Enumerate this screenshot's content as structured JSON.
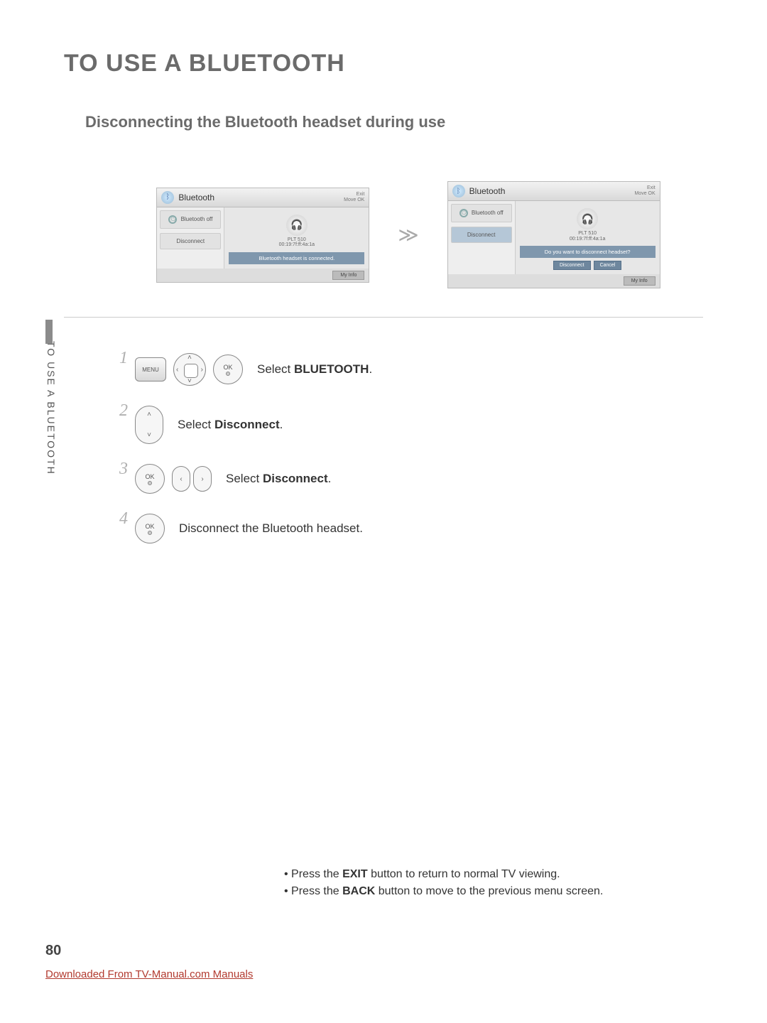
{
  "main_title": "TO USE A BLUETOOTH",
  "sub_title": "Disconnecting the Bluetooth headset during use",
  "sidetab": "TO USE A BLUETOOTH",
  "shot_common": {
    "title": "Bluetooth",
    "exit": "Exit",
    "move_ok": "Move   OK",
    "side_off": "Bluetooth off",
    "side_disconnect": "Disconnect",
    "device_name": "PLT 510",
    "device_mac": "00:19:7f:ff:4a:1a",
    "myinfo": "My Info"
  },
  "shot1": {
    "status": "Bluetooth headset is connected."
  },
  "shot2": {
    "prompt": "Do you want to disconnect headset?",
    "btn_disconnect": "Disconnect",
    "btn_cancel": "Cancel"
  },
  "steps": {
    "s1": {
      "num": "1",
      "pre": "Select ",
      "bold": "BLUETOOTH",
      "post": "."
    },
    "s2": {
      "num": "2",
      "pre": "Select ",
      "bold": "Disconnect",
      "post": "."
    },
    "s3": {
      "num": "3",
      "pre": "Select ",
      "bold": "Disconnect",
      "post": "."
    },
    "s4": {
      "num": "4",
      "text": "Disconnect the Bluetooth headset."
    }
  },
  "buttons": {
    "menu": "MENU",
    "ok": "OK"
  },
  "notes": {
    "n1a": "• Press the ",
    "n1b": "EXIT",
    "n1c": " button to return to normal TV viewing.",
    "n2a": "• Press the ",
    "n2b": "BACK",
    "n2c": " button to move to the previous menu screen."
  },
  "page_num": "80",
  "download": "Downloaded From TV-Manual.com Manuals"
}
